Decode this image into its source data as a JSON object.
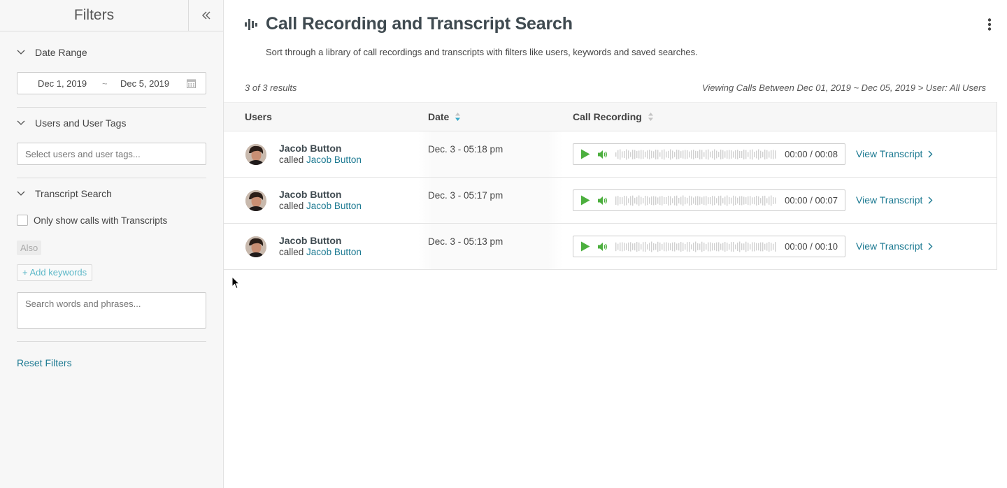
{
  "sidebar": {
    "title": "Filters",
    "collapse_icon": "double-chevron-left-icon",
    "date_section": {
      "label": "Date Range",
      "start": "Dec 1, 2019",
      "separator": "~",
      "end": "Dec 5, 2019"
    },
    "users_section": {
      "label": "Users and User Tags",
      "placeholder": "Select users and user tags..."
    },
    "transcript_section": {
      "label": "Transcript Search",
      "checkbox_label": "Only show calls with Transcripts",
      "also_label": "Also",
      "add_keywords_label": "+ Add keywords",
      "keywords_placeholder": "Search words and phrases..."
    },
    "reset_label": "Reset Filters"
  },
  "header": {
    "title": "Call Recording and Transcript Search",
    "subtitle": "Sort through a library of call recordings and transcripts with filters like users, keywords and saved searches.",
    "results_count": "3 of 3 results",
    "viewing_text": "Viewing Calls Between Dec 01, 2019 ~ Dec 05, 2019 > User: All Users"
  },
  "table": {
    "columns": [
      "Users",
      "Date",
      "Call Recording"
    ],
    "sorted_column": "Date",
    "rows": [
      {
        "user": "Jacob Button",
        "called_prefix": "called",
        "called_user": "Jacob Button",
        "date": "Dec. 3 - 05:18 pm",
        "time": "00:00 / 00:08",
        "action": "View Transcript"
      },
      {
        "user": "Jacob Button",
        "called_prefix": "called",
        "called_user": "Jacob Button",
        "date": "Dec. 3 - 05:17 pm",
        "time": "00:00 / 00:07",
        "action": "View Transcript"
      },
      {
        "user": "Jacob Button",
        "called_prefix": "called",
        "called_user": "Jacob Button",
        "date": "Dec. 3 - 05:13 pm",
        "time": "00:00 / 00:10",
        "action": "View Transcript"
      }
    ]
  },
  "colors": {
    "link": "#1d7a92",
    "play_green": "#4caf3e",
    "sort_active": "#39a9c9",
    "title": "#3f4a50"
  }
}
